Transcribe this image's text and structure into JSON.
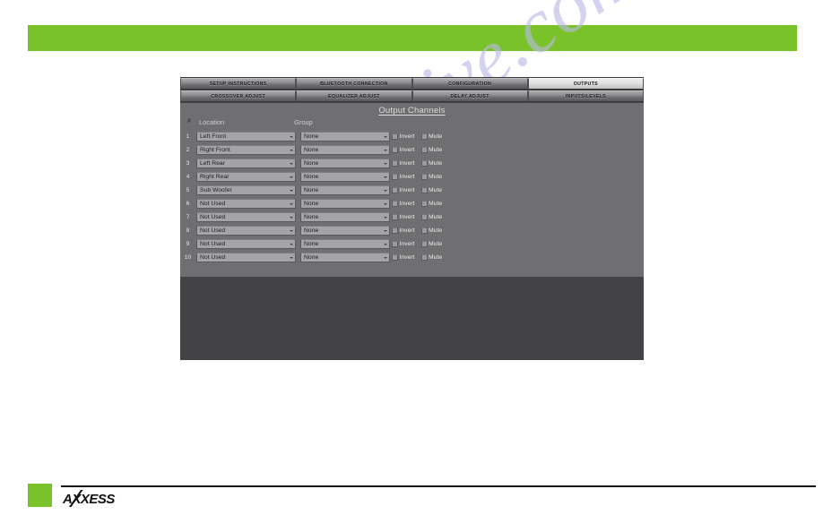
{
  "page": {
    "watermark": "manualslive.com",
    "background_color": "#ffffff"
  },
  "header": {
    "accent_color": "#7ac229"
  },
  "app": {
    "title": "Output Channels",
    "panel_color": "#6f6f71",
    "dark_panel_color": "#434345",
    "tabs": [
      {
        "label": "SETUP INSTRUCTIONS",
        "active": false
      },
      {
        "label": "BLUETOOTH CONNECTION",
        "active": false
      },
      {
        "label": "CONFIGURATION",
        "active": false
      },
      {
        "label": "OUTPUTS",
        "active": true
      },
      {
        "label": "CROSSOVER ADJUST",
        "active": false
      },
      {
        "label": "EQUALIZER ADJUST",
        "active": false
      },
      {
        "label": "DELAY ADJUST",
        "active": false
      },
      {
        "label": "INPUTS/LEVELS",
        "active": false
      }
    ],
    "columns": {
      "number": "#",
      "location": "Location",
      "group": "Group"
    },
    "checkbox_labels": {
      "invert": "Invert",
      "mute": "Mute"
    },
    "rows": [
      {
        "num": "1",
        "location": "Left Front",
        "group": "None",
        "invert": false,
        "mute": false
      },
      {
        "num": "2",
        "location": "Right Front",
        "group": "None",
        "invert": false,
        "mute": false
      },
      {
        "num": "3",
        "location": "Left Rear",
        "group": "None",
        "invert": false,
        "mute": false
      },
      {
        "num": "4",
        "location": "Right Rear",
        "group": "None",
        "invert": false,
        "mute": false
      },
      {
        "num": "5",
        "location": "Sub Woofer",
        "group": "None",
        "invert": false,
        "mute": false
      },
      {
        "num": "6",
        "location": "Not Used",
        "group": "None",
        "invert": false,
        "mute": false
      },
      {
        "num": "7",
        "location": "Not Used",
        "group": "None",
        "invert": false,
        "mute": false
      },
      {
        "num": "8",
        "location": "Not Used",
        "group": "None",
        "invert": false,
        "mute": false
      },
      {
        "num": "9",
        "location": "Not Used",
        "group": "None",
        "invert": false,
        "mute": false
      },
      {
        "num": "10",
        "location": "Not Used",
        "group": "None",
        "invert": false,
        "mute": false
      }
    ]
  },
  "footer": {
    "logo_text": "AXXESS",
    "swatch_color": "#7ac229"
  }
}
